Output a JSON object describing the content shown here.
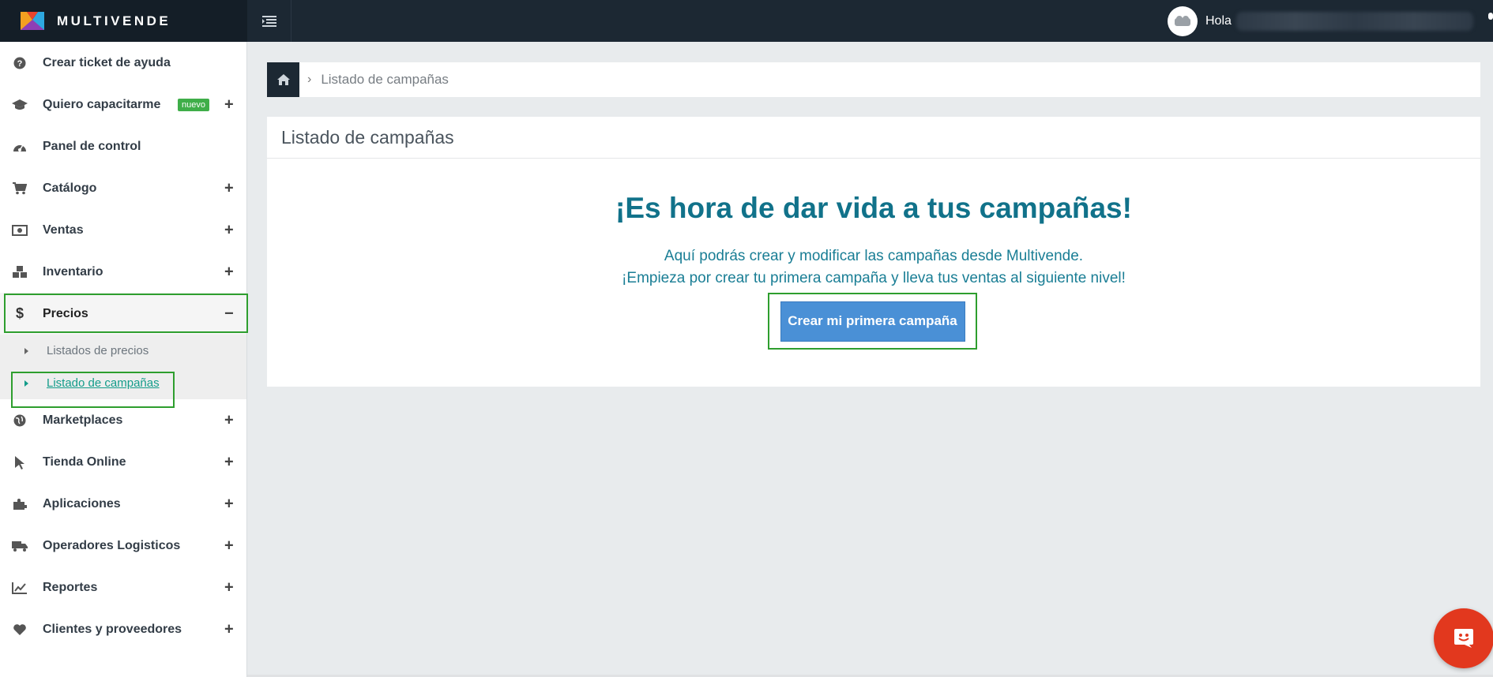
{
  "brand": {
    "name": "MULTIVENDE"
  },
  "topbar": {
    "greeting": "Hola"
  },
  "sidebar": {
    "items": [
      {
        "label": "Crear ticket de ayuda",
        "icon": "question-circle-icon",
        "expandable": false
      },
      {
        "label": "Quiero capacitarme",
        "icon": "graduation-cap-icon",
        "badge": "nuevo",
        "expandable": true
      },
      {
        "label": "Panel de control",
        "icon": "dashboard-icon",
        "expandable": false
      },
      {
        "label": "Catálogo",
        "icon": "cart-icon",
        "expandable": true
      },
      {
        "label": "Ventas",
        "icon": "money-icon",
        "expandable": true
      },
      {
        "label": "Inventario",
        "icon": "cubes-icon",
        "expandable": true
      },
      {
        "label": "Precios",
        "icon": "dollar-icon",
        "expandable": true,
        "expanded": true,
        "collapse_symbol": "−"
      },
      {
        "label": "Marketplaces",
        "icon": "globe-icon",
        "expandable": true
      },
      {
        "label": "Tienda Online",
        "icon": "pointer-icon",
        "expandable": true
      },
      {
        "label": "Aplicaciones",
        "icon": "puzzle-icon",
        "expandable": true
      },
      {
        "label": "Operadores Logisticos",
        "icon": "truck-icon",
        "expandable": true
      },
      {
        "label": "Reportes",
        "icon": "line-chart-icon",
        "expandable": true
      },
      {
        "label": "Clientes y proveedores",
        "icon": "heart-icon",
        "expandable": true
      }
    ],
    "expand_symbol": "+",
    "submenu_precios": [
      {
        "label": "Listados de precios",
        "current": false
      },
      {
        "label": "Listado de campañas",
        "current": true
      }
    ]
  },
  "breadcrumb": {
    "separator": "›",
    "current": "Listado de campañas"
  },
  "panel": {
    "title": "Listado de campañas",
    "hero_title": "¡Es hora de dar vida a tus campañas!",
    "hero_line1": "Aquí podrás crear y modificar las campañas desde Multivende.",
    "hero_line2": "¡Empieza por crear tu primera campaña y lleva tus ventas al siguiente nivel!",
    "cta_label": "Crear mi primera campaña"
  },
  "colors": {
    "topbar": "#1c2833",
    "accent_teal": "#11728a",
    "cta_blue": "#4a90d6",
    "badge_green": "#3fae49",
    "highlight_green": "#2e9e2e",
    "chat_red": "#e2381e"
  }
}
